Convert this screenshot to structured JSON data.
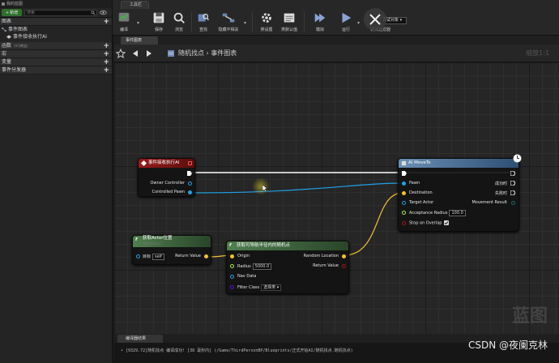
{
  "left_panel": {
    "title": "我的蓝图",
    "new_label": "新增",
    "search_placeholder": "搜索",
    "sections": [
      {
        "label": "图表"
      },
      {
        "label": "函数",
        "sub": "(0可覆盖)"
      },
      {
        "label": "宏"
      },
      {
        "label": "变量"
      },
      {
        "label": "事件分发器"
      }
    ],
    "graph_item": "事件图表",
    "event_item": "事件接收执行AI"
  },
  "toolbar": {
    "tab_label": "工具栏",
    "buttons": [
      {
        "label": "编译",
        "icon": "compile-icon"
      },
      {
        "label": "保存",
        "icon": "save-icon"
      },
      {
        "label": "浏览",
        "icon": "browse-icon"
      },
      {
        "label": "查找",
        "icon": "find-icon"
      },
      {
        "label": "隐藏不相关",
        "icon": "hide-unrelated-icon"
      },
      {
        "label": "类设置",
        "icon": "class-settings-icon"
      },
      {
        "label": "类默认值",
        "icon": "class-defaults-icon"
      },
      {
        "label": "模拟",
        "icon": "simulate-icon"
      },
      {
        "label": "运行",
        "icon": "play-icon"
      }
    ],
    "debug_select": "调试对象",
    "debug_filter": "调试过滤器"
  },
  "graph": {
    "tab_label": "事件图表",
    "breadcrumb_root": "随机找点",
    "breadcrumb_sep": "›",
    "breadcrumb_leaf": "事件图表",
    "zoom": "缩放1:1",
    "watermark": "蓝图"
  },
  "nodes": {
    "event": {
      "title": "事件接收执行AI",
      "pins": [
        "Owner Controller",
        "Controlled Pawn"
      ]
    },
    "get_actor_location": {
      "title": "获取Actor位置",
      "subtitle": "目标是Actor",
      "target_label": "目标",
      "target_value": "self",
      "output": "Return Value"
    },
    "random_point": {
      "title": "获取可导航半径内的随机点",
      "inputs": [
        "Origin",
        "Radius",
        "Nav Data",
        "Filter Class"
      ],
      "radius_value": "5000.0",
      "filter_value": "选择类",
      "outputs": [
        "Random Location",
        "Return Value"
      ]
    },
    "ai_moveto": {
      "title": "AI MoveTo",
      "inputs": [
        "Pawn",
        "Destination",
        "Target Actor",
        "Acceptance Radius",
        "Stop on Overlap"
      ],
      "acceptance_value": "100.0",
      "outputs": [
        "成功时",
        "失败时",
        "Movement Result"
      ]
    }
  },
  "log": {
    "tab_label": "编译器结果",
    "line": "• [9329.72]随机找点 编译成功! [38 毫秒内] (/Game/ThirdPersonBP/Blueprints/正式开始AI/随机找点.随机找点)"
  },
  "credit": "CSDN @夜阑克林",
  "colors": {
    "exec": "#ffffff",
    "object_pin": "#1fa3e8",
    "vector_pin": "#f2c22e",
    "float_pin": "#a7f04a",
    "bool_pin": "#a51616",
    "struct_pin": "#1b4fa3",
    "class_pin": "#5a12d6",
    "event_header": "#8a1515",
    "pure_header": "#3d6b3d",
    "latent_header": "#3c5d80"
  }
}
